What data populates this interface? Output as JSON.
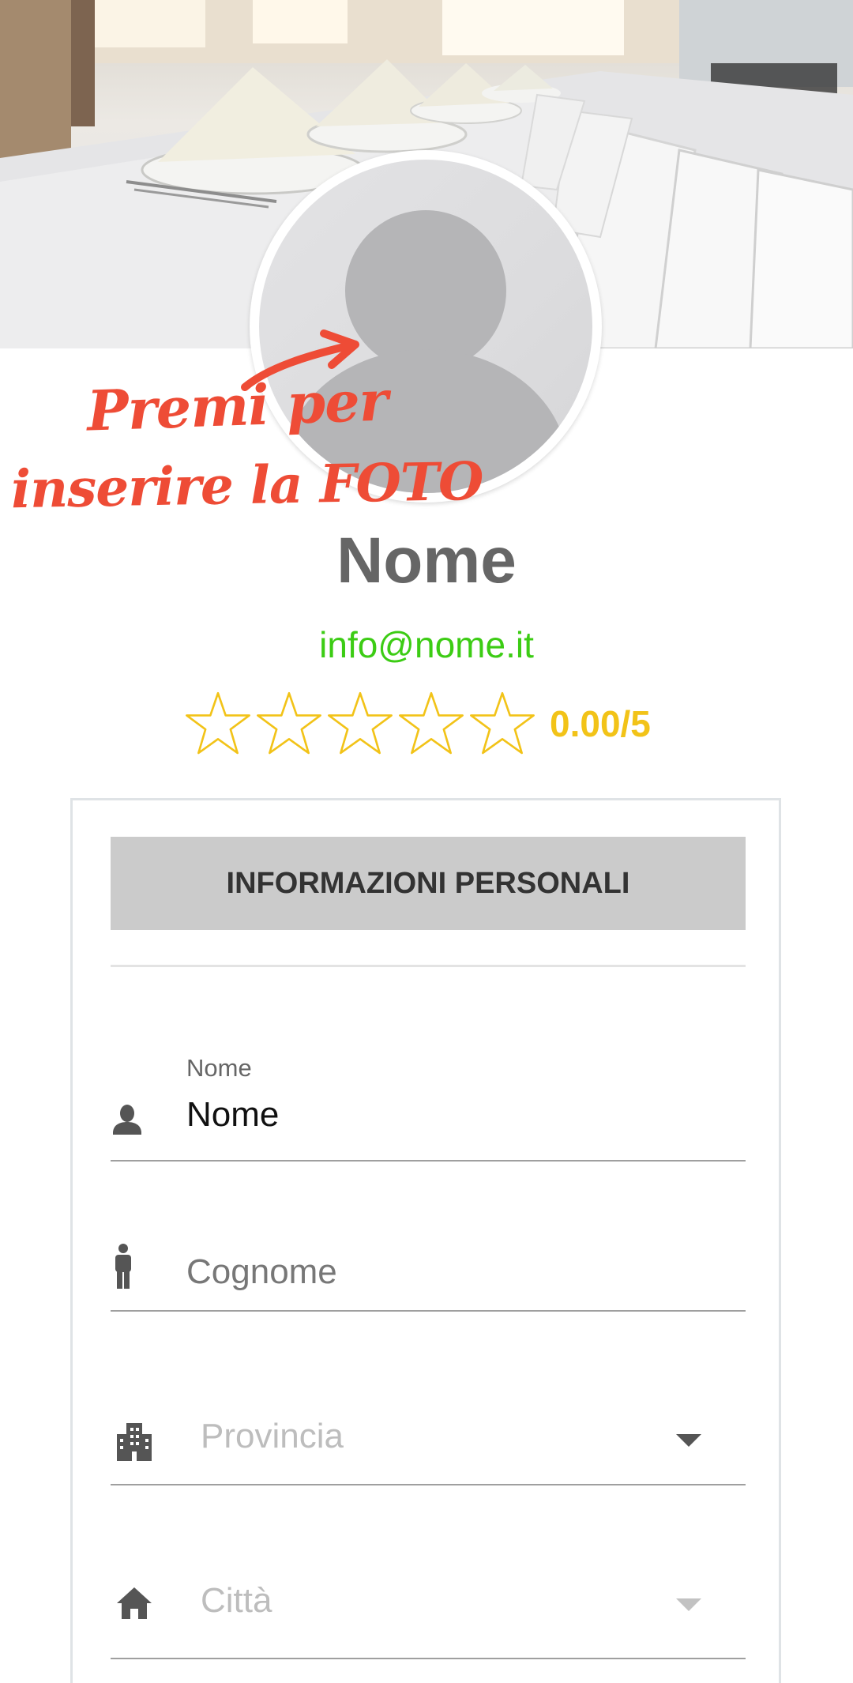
{
  "cover": {
    "alt_icon": "banquet-table-photo"
  },
  "avatar": {
    "icon": "user-placeholder-icon"
  },
  "hint": {
    "line1": "Premi per",
    "line2": "inserire la FOTO",
    "color": "#ee4c36"
  },
  "profile": {
    "name": "Nome",
    "email": "info@nome.it",
    "rating_value": 0.0,
    "rating_max": 5,
    "rating_text": "0.00/5",
    "email_color": "#3ccc14",
    "rating_color": "#f2c318"
  },
  "card": {
    "section_title": "INFORMAZIONI PERSONALI",
    "fields": {
      "nome": {
        "label": "Nome",
        "value": "Nome",
        "icon": "person-bust-icon"
      },
      "cognome": {
        "placeholder": "Cognome",
        "icon": "person-standing-icon"
      },
      "provincia": {
        "placeholder": "Provincia",
        "icon": "building-icon",
        "caret_icon": "dropdown-caret-icon"
      },
      "citta": {
        "placeholder": "Città",
        "icon": "home-icon",
        "caret_icon": "dropdown-caret-icon"
      }
    }
  }
}
